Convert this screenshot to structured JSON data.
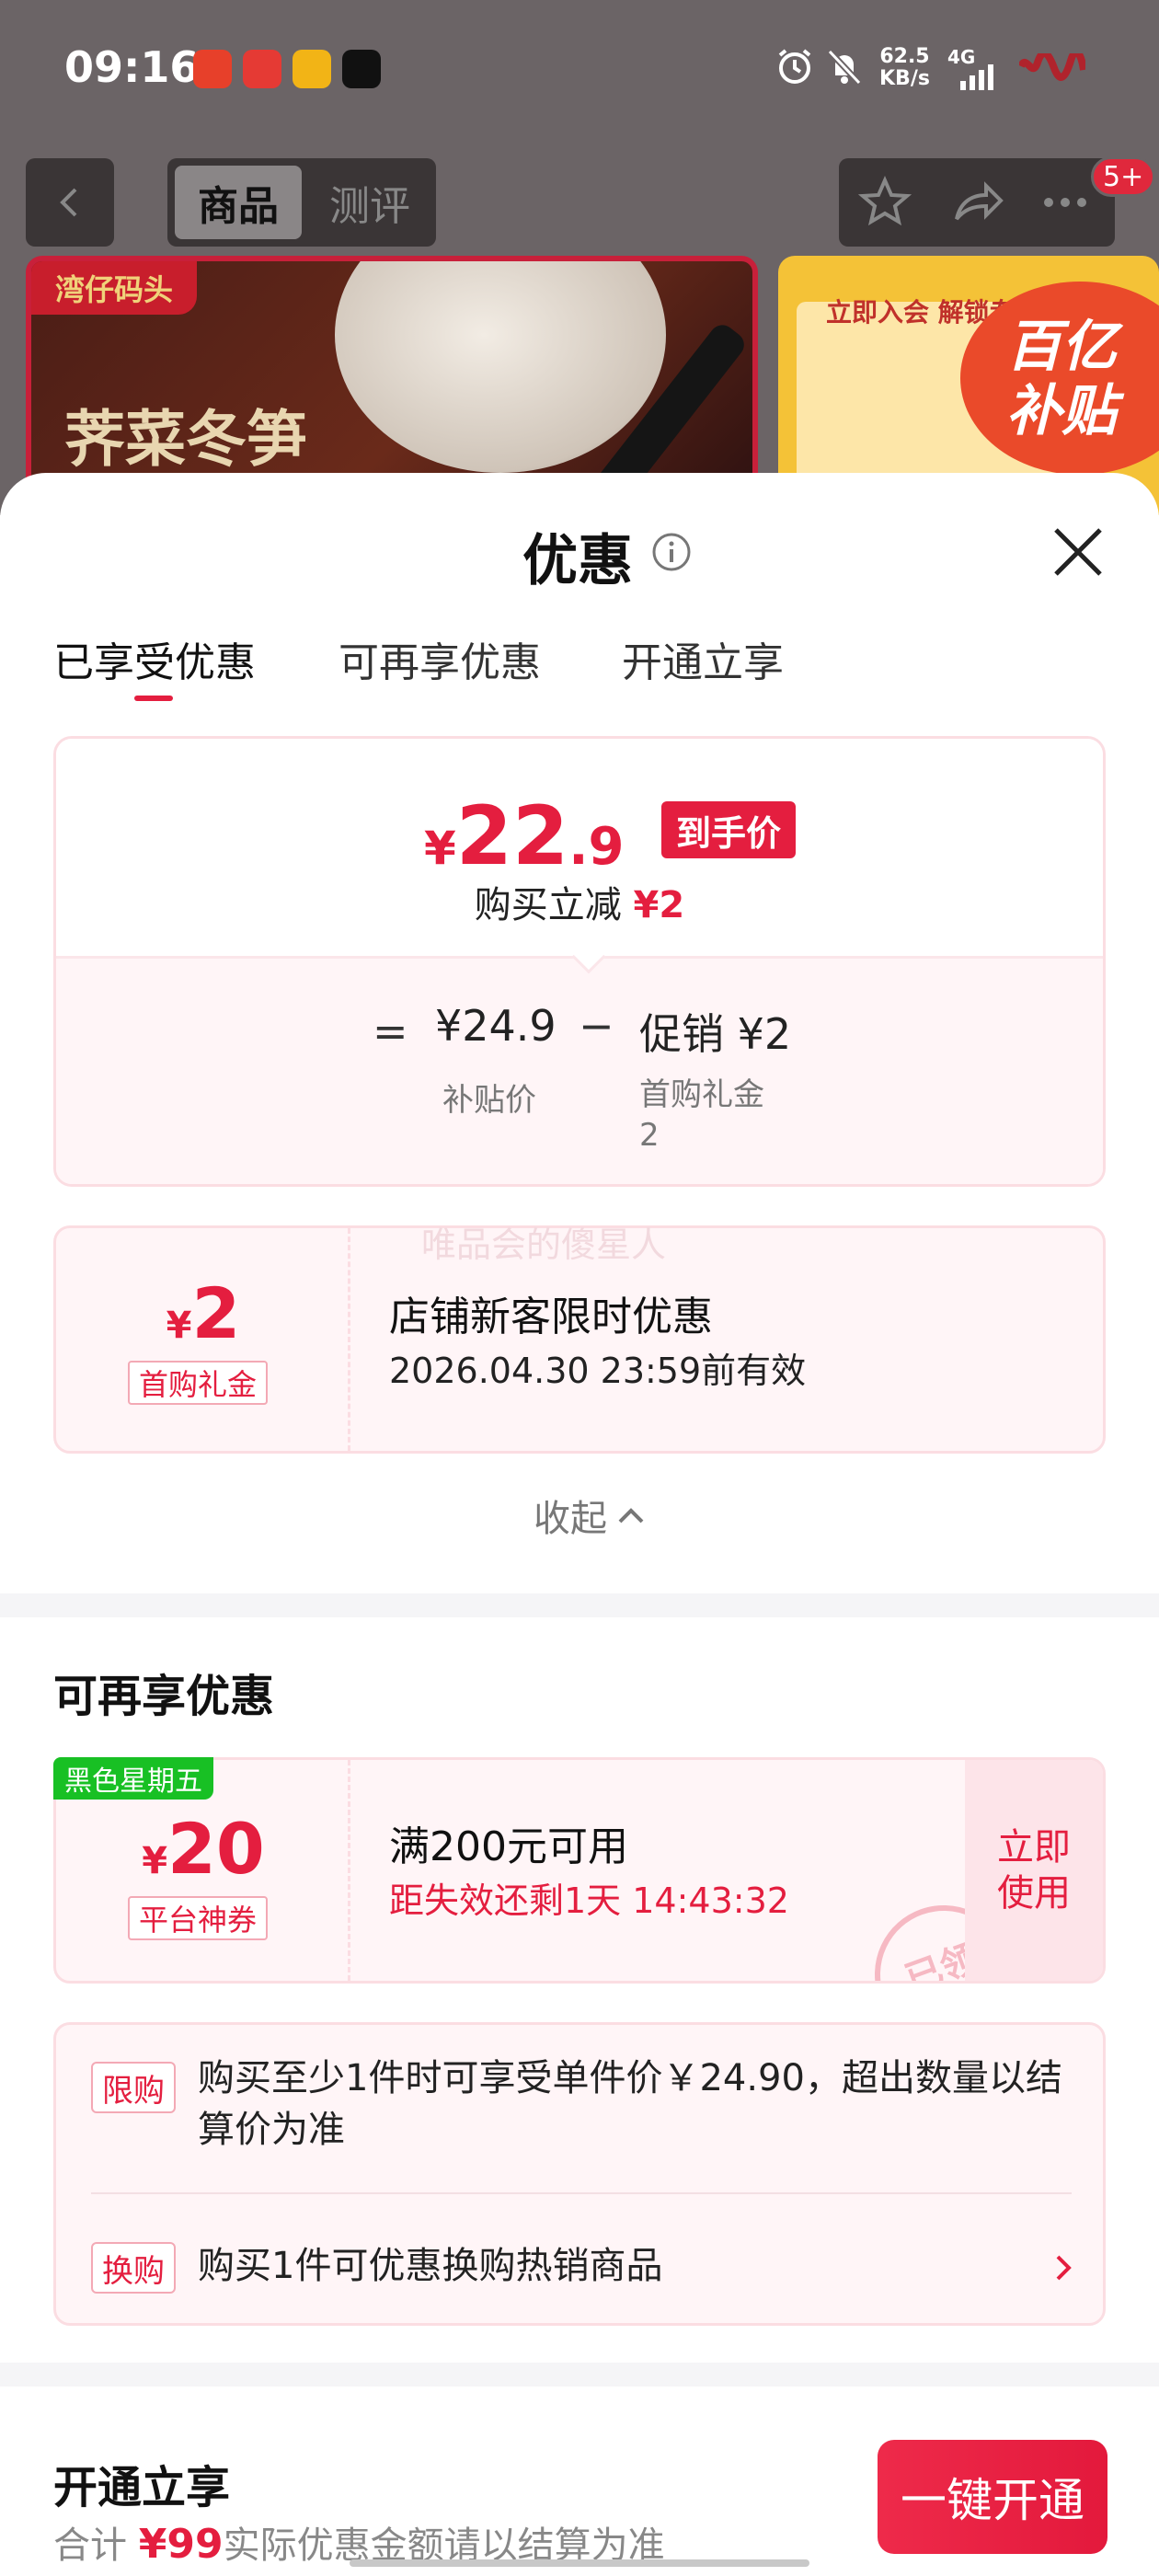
{
  "status_bar": {
    "time": "09:16",
    "net_speed_value": "62.5",
    "net_speed_unit": "KB/s",
    "network": "4G"
  },
  "nav": {
    "tabs": [
      "商品",
      "测评"
    ],
    "active_tab": "商品",
    "badge": "5+"
  },
  "background_banner": {
    "tag": "湾仔码头",
    "text": "荠菜冬笋",
    "right_head": "立即入会 解锁专",
    "subsidy_line1": "百亿",
    "subsidy_line2": "补贴"
  },
  "sheet": {
    "title": "优惠",
    "tabs": [
      "已享受优惠",
      "可再享优惠",
      "开通立享"
    ],
    "active_tab": "已享受优惠"
  },
  "price_card": {
    "currency": "¥",
    "final_int": "22",
    "final_dec": ".9",
    "final_tag": "到手价",
    "reduce_text": "购买立减",
    "reduce_amount": "¥2",
    "equals": "=",
    "subsidy_price": "¥24.9",
    "subsidy_label": "补贴价",
    "minus": "−",
    "promo": "促销 ¥2",
    "promo_label": "首购礼金",
    "promo_label_value": "2"
  },
  "enjoyed_coupon": {
    "currency": "¥",
    "amount": "2",
    "type": "首购礼金",
    "title": "店铺新客限时优惠",
    "validity": "2026.04.30 23:59前有效"
  },
  "watermark": "唯品会的傻星人",
  "collapse_label": "收起",
  "more_section": {
    "title": "可再享优惠",
    "badge": "黑色星期五",
    "coupon": {
      "currency": "¥",
      "amount": "20",
      "type": "平台神券",
      "title": "满200元可用",
      "countdown": "距失效还剩1天 14:43:32",
      "use_label_1": "立即",
      "use_label_2": "使用",
      "stamp": "已领"
    }
  },
  "rules": [
    {
      "tag": "限购",
      "text": "购买至少1件时可享受单件价￥24.90，超出数量以结算价为准"
    },
    {
      "tag": "换购",
      "text": "购买1件可优惠换购热销商品"
    }
  ],
  "open_section": {
    "title": "开通立享",
    "total_prefix": "合计",
    "total_amount": "¥99",
    "total_suffix": "实际优惠金额请以结算为准",
    "button": "一键开通"
  },
  "colors": {
    "accent_red": "#e41e3f",
    "green_badge": "#18c024",
    "card_bg": "#fff5f7"
  }
}
